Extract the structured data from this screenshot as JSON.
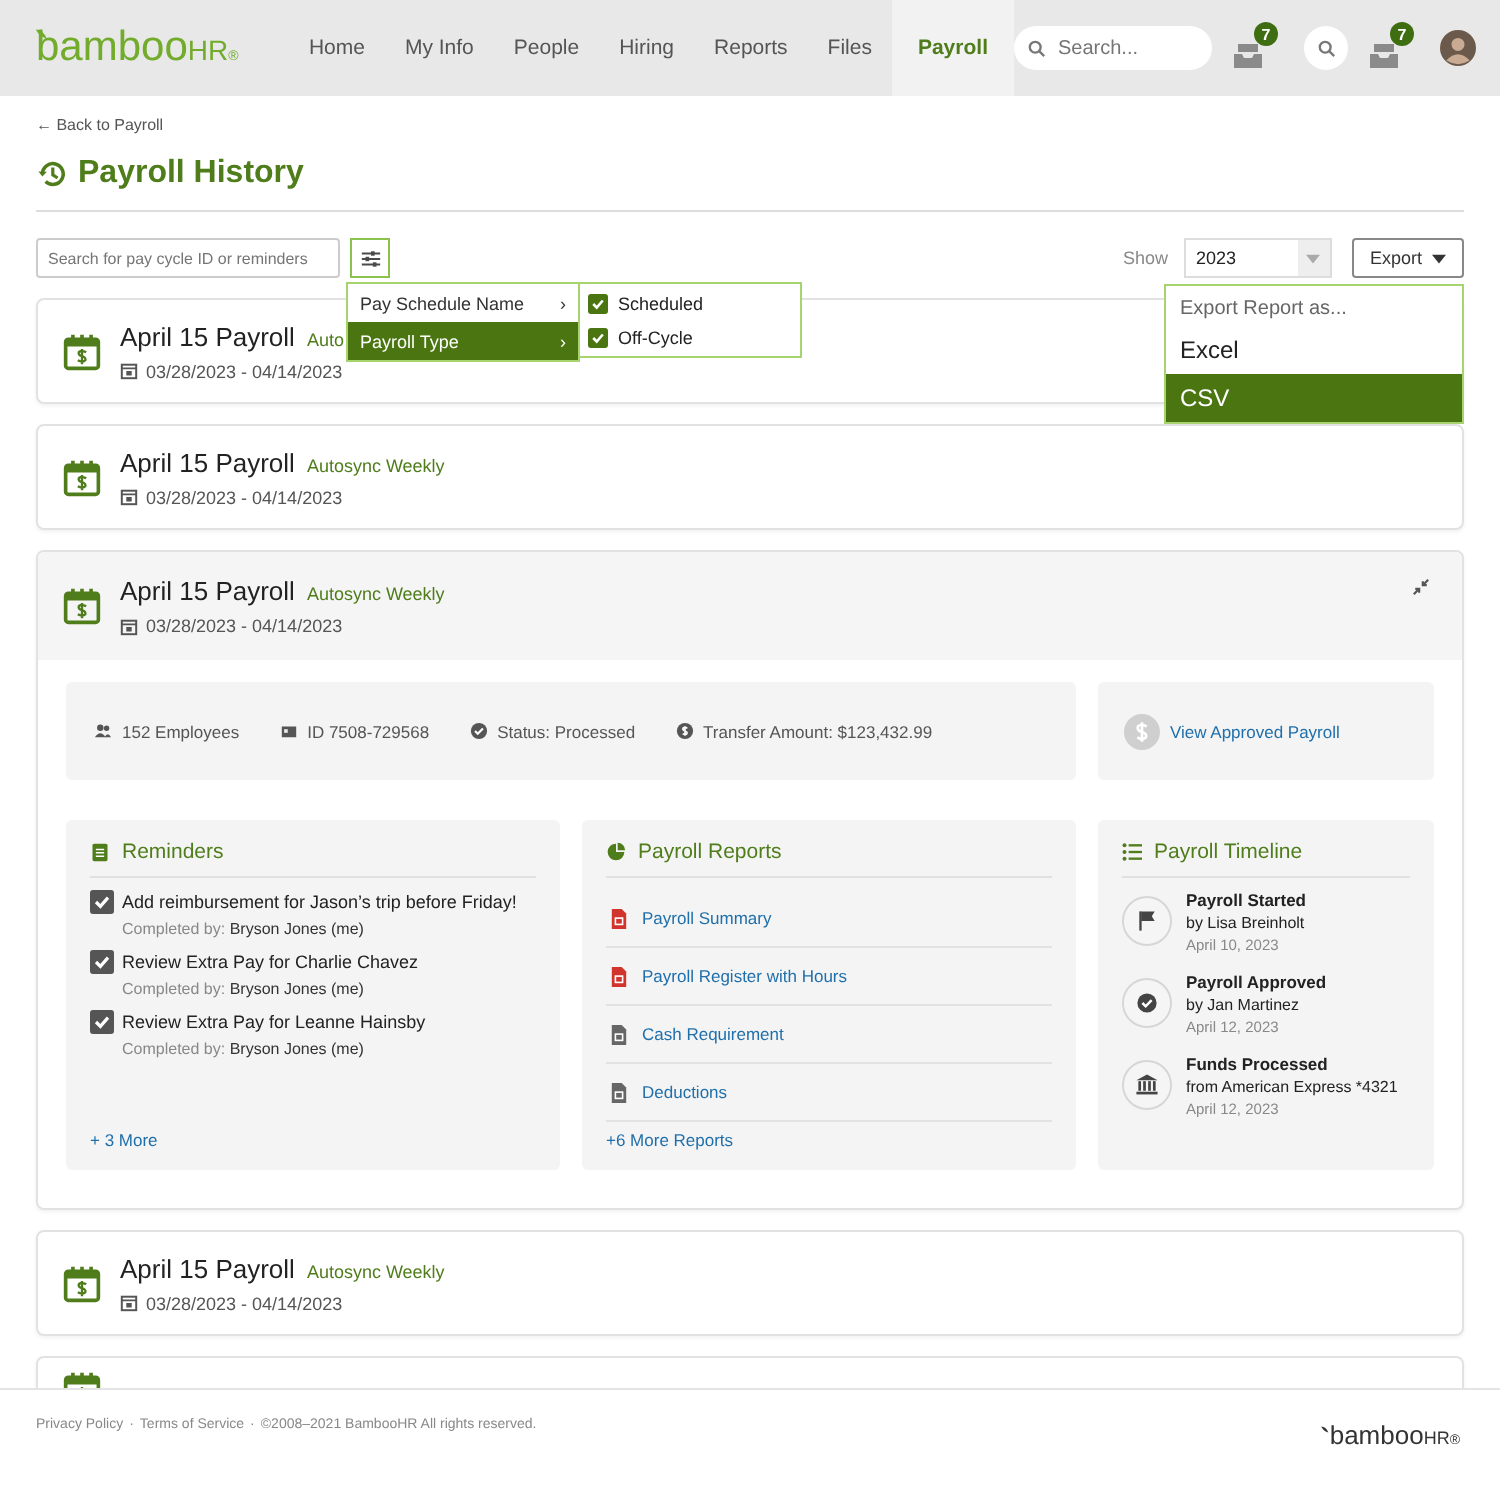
{
  "nav": {
    "logo": {
      "word": "bamboo",
      "suffix": "HR",
      "mark": "®"
    },
    "items": [
      {
        "label": "Home",
        "selected": false
      },
      {
        "label": "My Info",
        "selected": false
      },
      {
        "label": "People",
        "selected": false
      },
      {
        "label": "Hiring",
        "selected": false
      },
      {
        "label": "Reports",
        "selected": false
      },
      {
        "label": "Files",
        "selected": false
      },
      {
        "label": "Payroll",
        "selected": true
      }
    ],
    "search": {
      "placeholder": "Search..."
    },
    "badges": [
      "7",
      "7"
    ]
  },
  "back_link": "← Back to Payroll",
  "title": "Payroll History",
  "toolbar": {
    "search": {
      "placeholder": "Search for pay cycle ID or reminders"
    },
    "filter_active": true,
    "show_label": "Show",
    "year": "2023",
    "export": "Export"
  },
  "filter_menu": {
    "items": [
      {
        "label": "Pay Schedule Name",
        "arrow": "›",
        "selected": false
      },
      {
        "label": "Payroll Type",
        "arrow": "›",
        "selected": true
      }
    ],
    "options": [
      {
        "label": "Scheduled",
        "checked": true
      },
      {
        "label": "Off-Cycle",
        "checked": true
      }
    ]
  },
  "export_menu": {
    "heading": "Export Report as...",
    "options": [
      {
        "label": "Excel",
        "selected": false
      },
      {
        "label": "CSV",
        "selected": true
      }
    ]
  },
  "payrolls": [
    {
      "title": "April 15 Payroll",
      "schedule": "Auto",
      "dates": "03/28/2023 - 04/14/2023",
      "expanded": false
    },
    {
      "title": "April 15 Payroll",
      "schedule": "Autosync Weekly",
      "dates": "03/28/2023 - 04/14/2023",
      "expanded": false
    },
    {
      "title": "April 15 Payroll",
      "schedule": "Autosync Weekly",
      "dates": "03/28/2023 - 04/14/2023",
      "expanded": true,
      "detail": {
        "stats": [
          {
            "kind": "employees",
            "text": "152 Employees"
          },
          {
            "kind": "id",
            "text": "ID 7508-729568"
          },
          {
            "kind": "status",
            "text": "Status: Processed"
          },
          {
            "kind": "amount",
            "text": "Transfer Amount: $123,432.99"
          }
        ],
        "view_link": "View Approved Payroll",
        "reminders": {
          "title": "Reminders",
          "items": [
            {
              "text": "Add reimbursement for Jason’s trip before Friday!",
              "checked": true,
              "label": "Completed by:",
              "by": "Bryson Jones (me)"
            },
            {
              "text": "Review Extra Pay for Charlie Chavez",
              "checked": true,
              "label": "Completed by:",
              "by": "Bryson Jones (me)"
            },
            {
              "text": "Review Extra Pay for Leanne Hainsby",
              "checked": true,
              "label": "Completed by:",
              "by": "Bryson Jones (me)"
            }
          ],
          "more": "+ 3 More"
        },
        "reports": {
          "title": "Payroll Reports",
          "items": [
            {
              "label": "Payroll Summary",
              "color": "#d0342c"
            },
            {
              "label": "Payroll Register with Hours",
              "color": "#d0342c"
            },
            {
              "label": "Cash Requirement",
              "color": "#666666"
            },
            {
              "label": "Deductions",
              "color": "#666666"
            }
          ],
          "more": "+6 More Reports"
        },
        "timeline": {
          "title": "Payroll Timeline",
          "events": [
            {
              "kind": "flag",
              "title": "Payroll Started",
              "by": "by Lisa Breinholt",
              "date": "April 10, 2023"
            },
            {
              "kind": "check",
              "title": "Payroll Approved",
              "by": "by Jan Martinez",
              "date": "April 12, 2023"
            },
            {
              "kind": "bank",
              "title": "Funds Processed",
              "by": "from American Express *4321",
              "date": "April 12, 2023"
            }
          ]
        }
      }
    },
    {
      "title": "April 15 Payroll",
      "schedule": "Autosync Weekly",
      "dates": "03/28/2023 - 04/14/2023",
      "expanded": false
    },
    {
      "expanded": false
    }
  ],
  "footer": {
    "links": [
      "Privacy Policy",
      "Terms of Service"
    ],
    "separator": "·",
    "copyright": "©2008–2021 BambooHR All rights reserved.",
    "logo": {
      "word": "bamboo",
      "suffix": "HR",
      "mark": "®"
    }
  }
}
